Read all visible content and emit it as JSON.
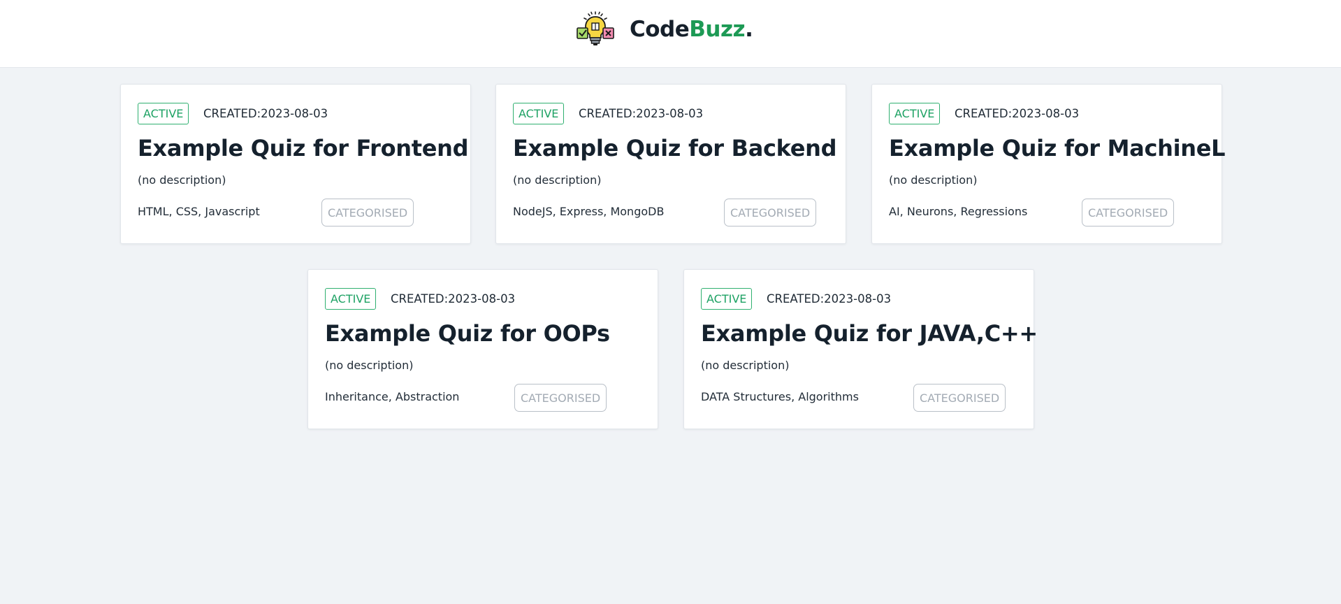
{
  "header": {
    "brand_part1": "Code",
    "brand_part2": "Buzz",
    "brand_dot": ".",
    "logo_icon": "lightbulb-quiz-icon",
    "colors": {
      "brand_dark": "#16202b",
      "brand_accent": "#1d9a55"
    }
  },
  "colors": {
    "page_background": "#f0f3f6",
    "card_background": "#ffffff",
    "active_green": "#1ea264",
    "muted_gray": "#a3abb4"
  },
  "quizzes": [
    {
      "status": "ACTIVE",
      "created": "CREATED:2023-08-03",
      "title": "Example Quiz for Frontend",
      "description": "(no description)",
      "tags": "HTML, CSS, Javascript",
      "category_label": "CATEGORISED"
    },
    {
      "status": "ACTIVE",
      "created": "CREATED:2023-08-03",
      "title": "Example Quiz for Backend",
      "description": "(no description)",
      "tags": "NodeJS, Express, MongoDB",
      "category_label": "CATEGORISED"
    },
    {
      "status": "ACTIVE",
      "created": "CREATED:2023-08-03",
      "title": "Example Quiz for MachineL",
      "description": "(no description)",
      "tags": "AI, Neurons, Regressions",
      "category_label": "CATEGORISED"
    },
    {
      "status": "ACTIVE",
      "created": "CREATED:2023-08-03",
      "title": "Example Quiz for OOPs",
      "description": "(no description)",
      "tags": "Inheritance, Abstraction",
      "category_label": "CATEGORISED"
    },
    {
      "status": "ACTIVE",
      "created": "CREATED:2023-08-03",
      "title": "Example Quiz for JAVA,C++",
      "description": "(no description)",
      "tags": "DATA Structures, Algorithms",
      "category_label": "CATEGORISED"
    }
  ]
}
